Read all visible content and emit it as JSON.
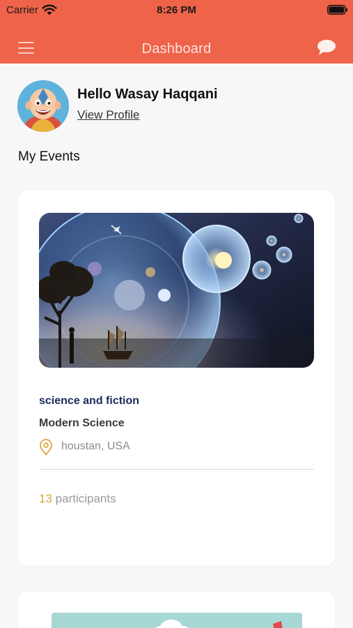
{
  "status_bar": {
    "carrier": "Carrier",
    "time": "8:26 PM",
    "icons": [
      "wifi-icon",
      "battery-icon"
    ]
  },
  "nav": {
    "title": "Dashboard",
    "left_icon": "menu-icon",
    "right_icon": "chat-icon"
  },
  "profile": {
    "greeting": "Hello Wasay Haqqani",
    "view_profile_label": "View Profile"
  },
  "section": {
    "title": "My Events"
  },
  "events": [
    {
      "category": "science and fiction",
      "title": "Modern Science",
      "location": "houstan, USA",
      "participants_count": "13",
      "participants_label": "participants"
    }
  ],
  "colors": {
    "brand": "#ee6349",
    "category": "#1c2b5c",
    "accent": "#d4a634",
    "location_pin": "#d9a73a"
  }
}
